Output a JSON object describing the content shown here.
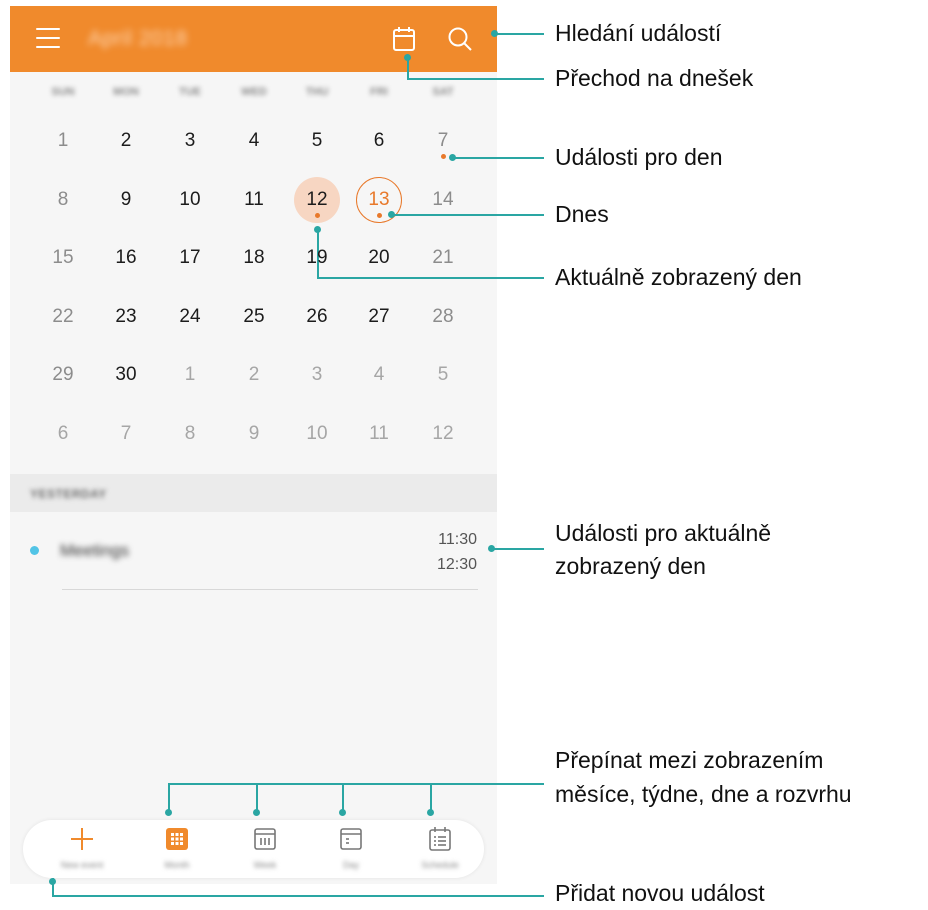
{
  "app": {
    "header_title": "April 2018",
    "accent_color": "#f08a2c",
    "header_icons": [
      "menu-icon",
      "today-icon",
      "search-icon"
    ]
  },
  "weekdays": [
    "SUN",
    "MON",
    "TUE",
    "WED",
    "THU",
    "FRI",
    "SAT"
  ],
  "calendar": {
    "weeks": [
      [
        "1",
        "2",
        "3",
        "4",
        "5",
        "6",
        "7"
      ],
      [
        "8",
        "9",
        "10",
        "11",
        "12",
        "13",
        "14"
      ],
      [
        "15",
        "16",
        "17",
        "18",
        "19",
        "20",
        "21"
      ],
      [
        "22",
        "23",
        "24",
        "25",
        "26",
        "27",
        "28"
      ],
      [
        "29",
        "30",
        "1",
        "2",
        "3",
        "4",
        "5"
      ],
      [
        "6",
        "7",
        "8",
        "9",
        "10",
        "11",
        "12"
      ]
    ],
    "selected_day": "12",
    "today": "13",
    "days_with_events": [
      "7",
      "12",
      "13"
    ]
  },
  "events_section": {
    "header": "YESTERDAY",
    "items": [
      {
        "title": "Meetings",
        "start": "11:30",
        "end": "12:30",
        "color": "#52c4e6"
      }
    ]
  },
  "bottom_tabs": [
    {
      "label": "New event",
      "icon": "plus-icon"
    },
    {
      "label": "Month",
      "icon": "month-view-icon"
    },
    {
      "label": "Week",
      "icon": "week-view-icon"
    },
    {
      "label": "Day",
      "icon": "day-view-icon"
    },
    {
      "label": "Schedule",
      "icon": "schedule-view-icon"
    }
  ],
  "annotations": {
    "search": "Hledání událostí",
    "today": "Přechod na dnešek",
    "day_events": "Události pro den",
    "today_marker": "Dnes",
    "selected_day": "Aktuálně zobrazený den",
    "events_line1": "Události pro aktuálně",
    "events_line2": "zobrazený den",
    "switch_line1": "Přepínat mezi zobrazením",
    "switch_line2": "měsíce, týdne, dne a rozvrhu",
    "new_event": "Přidat novou událost",
    "line_color": "#2aa6a3"
  }
}
